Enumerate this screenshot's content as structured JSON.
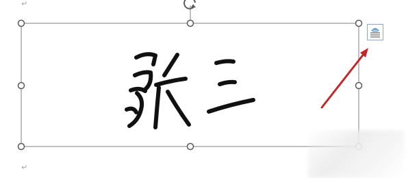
{
  "document": {
    "paragraph_mark": "↵"
  },
  "signature_image": {
    "text": "张三",
    "ink_color": "#111111"
  },
  "selection": {
    "frame_color": "#7f7f7f",
    "handle_fill": "#ffffff",
    "handle_stroke": "#595959"
  },
  "layout_options_button": {
    "icon": "layout-options-icon",
    "accent": "#2e75b6"
  },
  "annotation": {
    "arrow_color": "#c0292a"
  }
}
